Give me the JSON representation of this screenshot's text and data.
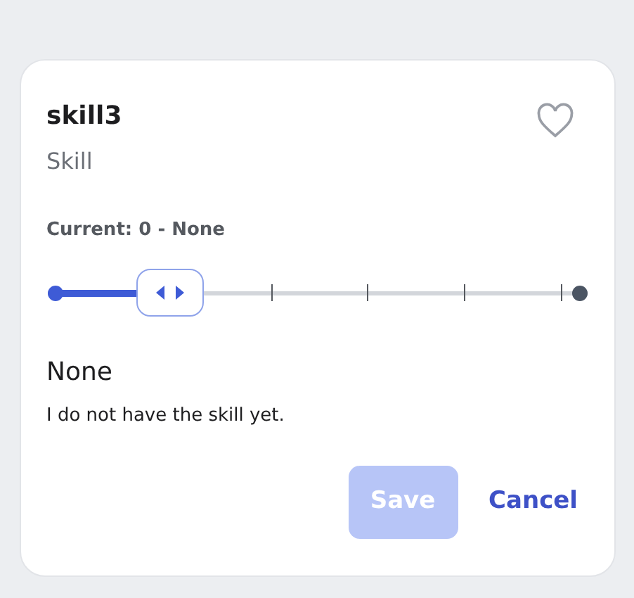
{
  "card": {
    "title": "skill3",
    "subtitle": "Skill",
    "favorite": false,
    "current": "Current: 0 - None",
    "slider": {
      "level": 0.22
    },
    "level_name": "None",
    "description": "I do not have the skill yet.",
    "buttons": [
      {
        "label": "Save",
        "kind": "primary",
        "disabled": true
      },
      {
        "label": "Cancel",
        "kind": "link",
        "disabled": false
      }
    ]
  }
}
